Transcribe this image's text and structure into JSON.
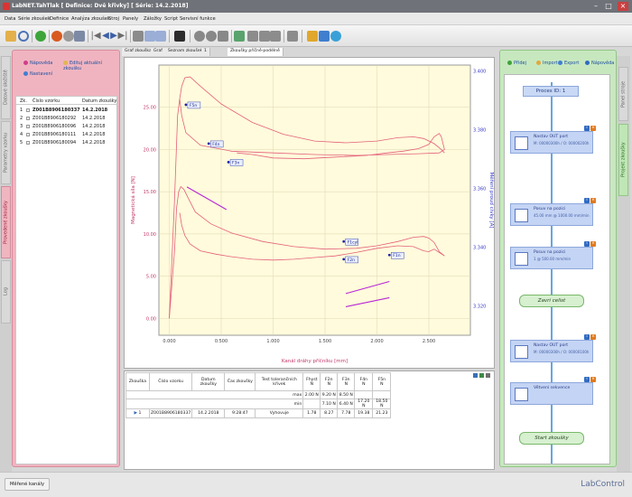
{
  "window": {
    "title": "LabNET.TahTlak [ Definice: Dvě křivky] [ Série: 14.2.2018]"
  },
  "menu": [
    "Data",
    "Série zkoušek",
    "Definice",
    "Analýza zkoušek",
    "Stroj",
    "Panely",
    "Záložky",
    "Script",
    "Servisní funkce"
  ],
  "doc_tabs": [
    "Graf zkouška",
    "Graf",
    "Seznam zkoušek",
    "1",
    "Zkoušky příčně-podélně"
  ],
  "left_tabs": [
    "Datové úložiště",
    "Parametry vzorku",
    "Provedené zkoušky",
    "Log"
  ],
  "left_actions": {
    "help": "Nápověda",
    "edit": "Edituj aktuální zkoušku",
    "settings": "Nastavení"
  },
  "sample_list": {
    "columns": [
      "Zk.",
      "Číslo vzorku",
      "Datum zkoušky"
    ],
    "rows": [
      {
        "n": "1",
        "id": "Z001B8906180337",
        "date": "14.2.2018",
        "bold": true
      },
      {
        "n": "2",
        "id": "Z001B8906180292",
        "date": "14.2.2018",
        "bold": false
      },
      {
        "n": "3",
        "id": "Z001B8906180096",
        "date": "14.2.2018",
        "bold": false
      },
      {
        "n": "4",
        "id": "Z001B8906180111",
        "date": "14.2.2018",
        "bold": false
      },
      {
        "n": "5",
        "id": "Z001B8906180094",
        "date": "14.2.2018",
        "bold": false
      }
    ]
  },
  "chart_data": {
    "type": "line",
    "xlabel": "Kanál dráhy příčníku [mm]",
    "ylabel": "Magnetická síla [N]",
    "y2label": "Měření proud cívky [A]",
    "xticks": [
      "0.000",
      "0.500",
      "1.000",
      "1.500",
      "2.000",
      "2.500"
    ],
    "yticks": [
      "0.00",
      "5.00",
      "10.00",
      "15.00",
      "20.00",
      "25.00"
    ],
    "y2ticks": [
      "3.320",
      "3.340",
      "3.360",
      "3.380",
      "3.400"
    ],
    "xlim": [
      -0.1,
      2.9
    ],
    "ylim": [
      -2,
      30
    ],
    "y2lim": [
      3.31,
      3.402
    ],
    "series": [
      {
        "x": [
          0.0,
          0.05,
          0.08,
          0.1,
          0.12,
          0.15,
          0.2,
          0.3,
          0.5,
          0.8,
          1.1,
          1.4,
          1.7,
          2.0,
          2.2,
          2.35,
          2.45,
          2.55,
          2.62,
          2.65
        ],
        "y": [
          0,
          14,
          24,
          26,
          27.5,
          28.5,
          28.6,
          27.5,
          25.4,
          23.2,
          21.8,
          21.0,
          20.8,
          21.0,
          21.4,
          21.5,
          21.3,
          20.7,
          20.0,
          19.6
        ]
      },
      {
        "x": [
          0.65,
          0.8,
          1.0,
          1.3,
          1.6,
          1.9,
          2.1,
          2.25,
          2.4,
          2.5,
          2.55,
          2.6,
          2.62,
          2.65,
          2.6,
          2.4,
          2.1,
          1.8,
          1.4,
          1.0,
          0.6,
          0.3,
          0.16,
          0.12,
          0.1
        ],
        "y": [
          19.6,
          19.4,
          19.0,
          18.9,
          19.1,
          19.3,
          19.6,
          19.8,
          20.1,
          20.6,
          21.5,
          21.9,
          21.5,
          20.0,
          19.6,
          19.5,
          19.4,
          19.3,
          19.4,
          19.6,
          19.8,
          20.5,
          22.0,
          24.0,
          26.0
        ]
      },
      {
        "x": [
          0.0,
          0.05,
          0.07,
          0.09,
          0.11,
          0.14,
          0.18,
          0.25,
          0.4,
          0.6,
          0.9,
          1.2,
          1.5,
          1.8,
          2.0,
          2.2,
          2.35,
          2.45,
          2.5,
          2.55,
          2.6,
          2.65
        ],
        "y": [
          0,
          8,
          13,
          15,
          15.6,
          15.3,
          14.3,
          12.6,
          11.2,
          10.1,
          9.1,
          8.5,
          8.2,
          8.3,
          8.6,
          9.1,
          9.6,
          9.7,
          9.5,
          9.0,
          7.9,
          7.4
        ]
      },
      {
        "x": [
          0.1,
          0.12,
          0.15,
          0.2,
          0.3,
          0.45,
          0.6,
          0.8,
          1.0,
          1.2,
          1.4,
          1.6,
          1.8,
          2.0,
          2.2,
          2.35,
          2.45,
          2.5,
          2.55,
          2.6,
          2.65
        ],
        "y": [
          12.5,
          11.0,
          9.8,
          8.8,
          8.0,
          7.6,
          7.3,
          7.0,
          6.9,
          7.0,
          7.2,
          7.4,
          7.8,
          8.3,
          8.6,
          8.5,
          8.0,
          7.9,
          8.2,
          7.8,
          7.4
        ]
      }
    ],
    "segments_y2": [
      {
        "x": [
          0.17,
          0.55
        ],
        "y": [
          3.3605,
          3.3528
        ]
      },
      {
        "x": [
          1.7,
          2.12
        ],
        "y": [
          3.3242,
          3.3283
        ]
      },
      {
        "x": [
          1.7,
          2.12
        ],
        "y": [
          3.3197,
          3.3228
        ]
      }
    ],
    "labels": [
      {
        "text": "F5n",
        "x": 0.16,
        "y": 25.3
      },
      {
        "text": "F4n",
        "x": 0.38,
        "y": 20.7
      },
      {
        "text": "F3n",
        "x": 0.57,
        "y": 18.5
      },
      {
        "text": "F1cyl",
        "x": 1.68,
        "y": 9.1
      },
      {
        "text": "F2n",
        "x": 1.68,
        "y": 7.0
      },
      {
        "text": "F1n",
        "x": 2.12,
        "y": 7.5
      }
    ]
  },
  "results": {
    "columns": [
      [
        "Zkouška",
        ""
      ],
      [
        "Číslo vzorku",
        ""
      ],
      [
        "Datum zkoušky",
        ""
      ],
      [
        "Čas zkoušky",
        ""
      ],
      [
        "Test tolerančních křivek",
        ""
      ],
      [
        "Fhyst",
        "N"
      ],
      [
        "F2n",
        "N"
      ],
      [
        "F3n",
        "N"
      ],
      [
        "F4n",
        "N"
      ],
      [
        "F5n",
        "N"
      ]
    ],
    "max": [
      "2.00 N",
      "9.20 N",
      "8.50 N",
      "",
      ""
    ],
    "min": [
      "",
      "7.10 N",
      "6.40 N",
      "17.20 N",
      "18.50 N",
      "19.80 N"
    ],
    "row": [
      "1",
      "Z001B8906180337",
      "14.2.2018",
      "9:28:47",
      "Vyhovuje",
      "1.78",
      "8.27",
      "7.78",
      "19.38",
      "21.23",
      "24.93"
    ]
  },
  "right_tabs": [
    "Panel stroje",
    "Projekt zkoušky"
  ],
  "right_actions": {
    "add": "Přidej",
    "import": "Import",
    "export": "Export",
    "help": "Nápověda"
  },
  "flow": {
    "title": "Proces ID: 1",
    "blocks": [
      {
        "l1": "Nastav OUT port",
        "l2": "M: 00000300h / O: 00000200h"
      },
      {
        "l1": "Posuv na pozici",
        "l2": "45.00 mm @ 1000.00 mm/min"
      },
      {
        "l1": "Posuv na pozici",
        "l2": "1 @ 500.00 mm/min"
      },
      {
        "l1": "Nastav OUT port",
        "l2": "M: 00000300h / O: 00000100h"
      },
      {
        "l1": "Větvení sekvence",
        "l2": ""
      }
    ],
    "pills": [
      "Zavri celist",
      "Start zkoušky"
    ]
  },
  "status": {
    "measured_channels": "Měřené kanály",
    "brand": "LabControl"
  }
}
